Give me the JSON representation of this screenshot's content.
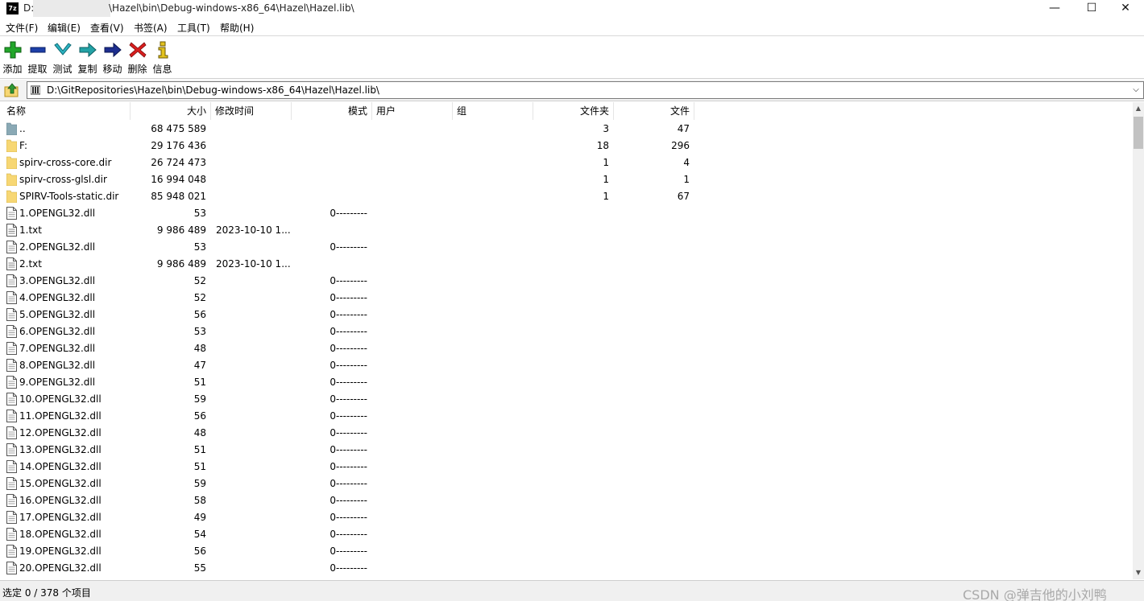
{
  "window": {
    "title_prefix": "D:",
    "title_suffix": "\\Hazel\\bin\\Debug-windows-x86_64\\Hazel\\Hazel.lib\\",
    "app_icon_text": "7z",
    "minimize": "—",
    "maximize": "☐",
    "close": "✕"
  },
  "menu": [
    "文件(F)",
    "编辑(E)",
    "查看(V)",
    "书签(A)",
    "工具(T)",
    "帮助(H)"
  ],
  "toolbar": {
    "add": "添加",
    "extract": "提取",
    "test": "测试",
    "copy": "复制",
    "move": "移动",
    "delete": "删除",
    "info": "信息"
  },
  "address": {
    "path": "D:\\GitRepositories\\Hazel\\bin\\Debug-windows-x86_64\\Hazel\\Hazel.lib\\"
  },
  "columns": {
    "name": "名称",
    "size": "大小",
    "modified": "修改时间",
    "mode": "模式",
    "user": "用户",
    "group": "组",
    "folders": "文件夹",
    "files": "文件"
  },
  "rows": [
    {
      "name": "..",
      "size": "68 475 589",
      "modified": "",
      "mode": "",
      "folders": "3",
      "files": "47",
      "icon": "parent-folder-icon"
    },
    {
      "name": "F:",
      "size": "29 176 436",
      "modified": "",
      "mode": "",
      "folders": "18",
      "files": "296",
      "icon": "folder-icon"
    },
    {
      "name": "spirv-cross-core.dir",
      "size": "26 724 473",
      "modified": "",
      "mode": "",
      "folders": "1",
      "files": "4",
      "icon": "folder-icon"
    },
    {
      "name": "spirv-cross-glsl.dir",
      "size": "16 994 048",
      "modified": "",
      "mode": "",
      "folders": "1",
      "files": "1",
      "icon": "folder-icon"
    },
    {
      "name": "SPIRV-Tools-static.dir",
      "size": "85 948 021",
      "modified": "",
      "mode": "",
      "folders": "1",
      "files": "67",
      "icon": "folder-icon"
    },
    {
      "name": "1.OPENGL32.dll",
      "size": "53",
      "modified": "",
      "mode": "0---------",
      "folders": "",
      "files": "",
      "icon": "dll-file-icon"
    },
    {
      "name": "1.txt",
      "size": "9 986 489",
      "modified": "2023-10-10 1...",
      "mode": "",
      "folders": "",
      "files": "",
      "icon": "text-file-icon"
    },
    {
      "name": "2.OPENGL32.dll",
      "size": "53",
      "modified": "",
      "mode": "0---------",
      "folders": "",
      "files": "",
      "icon": "dll-file-icon"
    },
    {
      "name": "2.txt",
      "size": "9 986 489",
      "modified": "2023-10-10 1...",
      "mode": "",
      "folders": "",
      "files": "",
      "icon": "text-file-icon"
    },
    {
      "name": "3.OPENGL32.dll",
      "size": "52",
      "modified": "",
      "mode": "0---------",
      "folders": "",
      "files": "",
      "icon": "dll-file-icon"
    },
    {
      "name": "4.OPENGL32.dll",
      "size": "52",
      "modified": "",
      "mode": "0---------",
      "folders": "",
      "files": "",
      "icon": "dll-file-icon"
    },
    {
      "name": "5.OPENGL32.dll",
      "size": "56",
      "modified": "",
      "mode": "0---------",
      "folders": "",
      "files": "",
      "icon": "dll-file-icon"
    },
    {
      "name": "6.OPENGL32.dll",
      "size": "53",
      "modified": "",
      "mode": "0---------",
      "folders": "",
      "files": "",
      "icon": "dll-file-icon"
    },
    {
      "name": "7.OPENGL32.dll",
      "size": "48",
      "modified": "",
      "mode": "0---------",
      "folders": "",
      "files": "",
      "icon": "dll-file-icon"
    },
    {
      "name": "8.OPENGL32.dll",
      "size": "47",
      "modified": "",
      "mode": "0---------",
      "folders": "",
      "files": "",
      "icon": "dll-file-icon"
    },
    {
      "name": "9.OPENGL32.dll",
      "size": "51",
      "modified": "",
      "mode": "0---------",
      "folders": "",
      "files": "",
      "icon": "dll-file-icon"
    },
    {
      "name": "10.OPENGL32.dll",
      "size": "59",
      "modified": "",
      "mode": "0---------",
      "folders": "",
      "files": "",
      "icon": "dll-file-icon"
    },
    {
      "name": "11.OPENGL32.dll",
      "size": "56",
      "modified": "",
      "mode": "0---------",
      "folders": "",
      "files": "",
      "icon": "dll-file-icon"
    },
    {
      "name": "12.OPENGL32.dll",
      "size": "48",
      "modified": "",
      "mode": "0---------",
      "folders": "",
      "files": "",
      "icon": "dll-file-icon"
    },
    {
      "name": "13.OPENGL32.dll",
      "size": "51",
      "modified": "",
      "mode": "0---------",
      "folders": "",
      "files": "",
      "icon": "dll-file-icon"
    },
    {
      "name": "14.OPENGL32.dll",
      "size": "51",
      "modified": "",
      "mode": "0---------",
      "folders": "",
      "files": "",
      "icon": "dll-file-icon"
    },
    {
      "name": "15.OPENGL32.dll",
      "size": "59",
      "modified": "",
      "mode": "0---------",
      "folders": "",
      "files": "",
      "icon": "dll-file-icon"
    },
    {
      "name": "16.OPENGL32.dll",
      "size": "58",
      "modified": "",
      "mode": "0---------",
      "folders": "",
      "files": "",
      "icon": "dll-file-icon"
    },
    {
      "name": "17.OPENGL32.dll",
      "size": "49",
      "modified": "",
      "mode": "0---------",
      "folders": "",
      "files": "",
      "icon": "dll-file-icon"
    },
    {
      "name": "18.OPENGL32.dll",
      "size": "54",
      "modified": "",
      "mode": "0---------",
      "folders": "",
      "files": "",
      "icon": "dll-file-icon"
    },
    {
      "name": "19.OPENGL32.dll",
      "size": "56",
      "modified": "",
      "mode": "0---------",
      "folders": "",
      "files": "",
      "icon": "dll-file-icon"
    },
    {
      "name": "20.OPENGL32.dll",
      "size": "55",
      "modified": "",
      "mode": "0---------",
      "folders": "",
      "files": "",
      "icon": "dll-file-icon"
    }
  ],
  "status": {
    "text": "选定 0 / 378 个项目",
    "watermark": "CSDN @弹吉他的小刘鸭"
  },
  "colors": {
    "folder": "#f7d774",
    "parent_folder": "#8aa9b5",
    "add": "#22a62a",
    "extract": "#1d3fa8",
    "test": "#2cb3c2",
    "copy": "#23a2a6",
    "move": "#1d2e8f",
    "delete": "#d81e1e",
    "info": "#e3c21e"
  }
}
